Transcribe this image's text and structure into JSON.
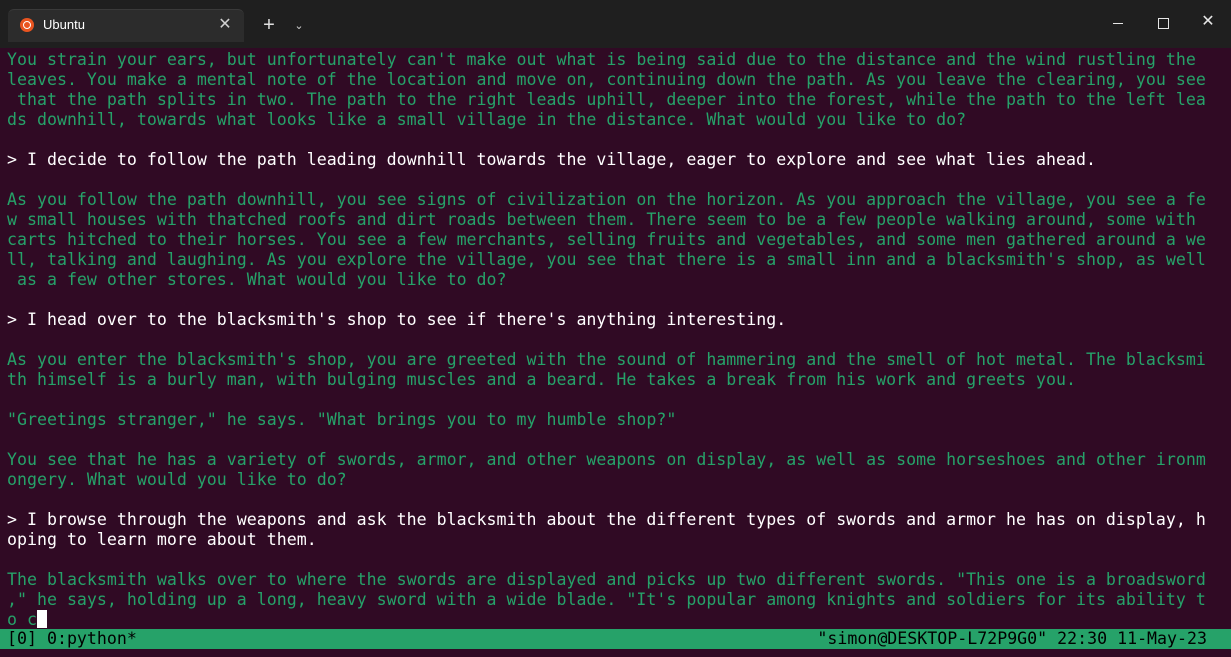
{
  "window": {
    "tab_title": "Ubuntu",
    "tab_close_glyph": "✕",
    "new_tab_glyph": "+",
    "dropdown_glyph": "⌄",
    "close_glyph": "✕"
  },
  "colors": {
    "terminal_background": "#300a24",
    "output_text": "#26a269",
    "input_text": "#ffffff",
    "status_bar": "#26a269",
    "tab_bar": "#1f1f1f",
    "ubuntu_accent": "#e95420"
  },
  "icons": {
    "tab": "ubuntu-logo-icon",
    "tab_close": "close-icon",
    "new_tab": "plus-icon",
    "dropdown": "chevron-down-icon",
    "minimize": "minimize-icon",
    "maximize": "maximize-icon",
    "close": "close-icon"
  },
  "terminal": {
    "lines": [
      {
        "text": "You strain your ears, but unfortunately can't make out what is being said due to the distance and the wind rustling the",
        "type": "output"
      },
      {
        "text": "leaves. You make a mental note of the location and move on, continuing down the path. As you leave the clearing, you see",
        "type": "output"
      },
      {
        "text": " that the path splits in two. The path to the right leads uphill, deeper into the forest, while the path to the left lea",
        "type": "output"
      },
      {
        "text": "ds downhill, towards what looks like a small village in the distance. What would you like to do?",
        "type": "output"
      },
      {
        "text": "",
        "type": "output"
      },
      {
        "text": "> I decide to follow the path leading downhill towards the village, eager to explore and see what lies ahead.",
        "type": "input"
      },
      {
        "text": "",
        "type": "output"
      },
      {
        "text": "As you follow the path downhill, you see signs of civilization on the horizon. As you approach the village, you see a fe",
        "type": "output"
      },
      {
        "text": "w small houses with thatched roofs and dirt roads between them. There seem to be a few people walking around, some with",
        "type": "output"
      },
      {
        "text": "carts hitched to their horses. You see a few merchants, selling fruits and vegetables, and some men gathered around a we",
        "type": "output"
      },
      {
        "text": "ll, talking and laughing. As you explore the village, you see that there is a small inn and a blacksmith's shop, as well",
        "type": "output"
      },
      {
        "text": " as a few other stores. What would you like to do?",
        "type": "output"
      },
      {
        "text": "",
        "type": "output"
      },
      {
        "text": "> I head over to the blacksmith's shop to see if there's anything interesting.",
        "type": "input"
      },
      {
        "text": "",
        "type": "output"
      },
      {
        "text": "As you enter the blacksmith's shop, you are greeted with the sound of hammering and the smell of hot metal. The blacksmi",
        "type": "output"
      },
      {
        "text": "th himself is a burly man, with bulging muscles and a beard. He takes a break from his work and greets you.",
        "type": "output"
      },
      {
        "text": "",
        "type": "output"
      },
      {
        "text": "\"Greetings stranger,\" he says. \"What brings you to my humble shop?\"",
        "type": "output"
      },
      {
        "text": "",
        "type": "output"
      },
      {
        "text": "You see that he has a variety of swords, armor, and other weapons on display, as well as some horseshoes and other ironm",
        "type": "output"
      },
      {
        "text": "ongery. What would you like to do?",
        "type": "output"
      },
      {
        "text": "",
        "type": "output"
      },
      {
        "text": "> I browse through the weapons and ask the blacksmith about the different types of swords and armor he has on display, h",
        "type": "input"
      },
      {
        "text": "oping to learn more about them.",
        "type": "input"
      },
      {
        "text": "",
        "type": "output"
      },
      {
        "text": "The blacksmith walks over to where the swords are displayed and picks up two different swords. \"This one is a broadsword",
        "type": "output"
      },
      {
        "text": ",\" he says, holding up a long, heavy sword with a wide blade. \"It's popular among knights and soldiers for its ability t",
        "type": "output"
      },
      {
        "text": "o c",
        "type": "output",
        "cursor": true
      }
    ]
  },
  "statusbar": {
    "left": "[0] 0:python*",
    "right": "\"simon@DESKTOP-L72P9G0\" 22:30 11-May-23"
  }
}
